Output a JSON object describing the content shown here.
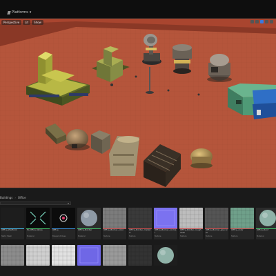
{
  "toolbar": {
    "platforms_label": "Platforms",
    "platforms_chevron": "▾"
  },
  "viewport": {
    "buttons": [
      {
        "label": "Perspective",
        "icon": "perspective-icon"
      },
      {
        "label": "Lit",
        "icon": "lit-icon"
      },
      {
        "label": "Show",
        "icon": "show-icon"
      }
    ],
    "right_icons": [
      "move-icon",
      "rotate-icon",
      "scale-icon",
      "grid-snap-icon",
      "camera-speed-icon"
    ],
    "ground_color": "#b5553b"
  },
  "content_browser": {
    "breadcrumb": [
      "Buildings",
      "Office"
    ],
    "breadcrumb_sep": "›",
    "filter_chevron": "▾",
    "assets": [
      {
        "name": "Office_Platform",
        "type": "Static Mesh",
        "thumb": "dark-platform",
        "color": "#1d1d1d",
        "bar": "#46b6e8"
      },
      {
        "name": "M_Office_Wires",
        "type": "Material",
        "thumb": "wire-pattern",
        "color": "#0a0a0a",
        "bar": "#43c06a"
      },
      {
        "name": "Office",
        "type": "Blueprint Class",
        "thumb": "office-blueprint",
        "color": "#0c0c0c",
        "bar": "#3b8fd9"
      },
      {
        "name": "Office_Border",
        "type": "Material",
        "thumb": "sphere-grey",
        "color": "#2b2b2b",
        "bar": "#43c06a"
      },
      {
        "name": "Office_Border_color",
        "type": "Texture",
        "thumb": "grey-panel",
        "color": "#7c7c7c",
        "bar": "#c94b4b"
      },
      {
        "name": "Office_Border_metallic",
        "type": "Texture",
        "thumb": "dark-panel",
        "color": "#3a3a3a",
        "bar": "#c94b4b"
      },
      {
        "name": "Office_Border_normal",
        "type": "Texture",
        "thumb": "normal-map",
        "color": "#7b72f0",
        "bar": "#c94b4b"
      },
      {
        "name": "Office_Border_roughness",
        "type": "Texture",
        "thumb": "light-panel",
        "color": "#bdbdbd",
        "bar": "#c94b4b"
      },
      {
        "name": "Office_Border_specular",
        "type": "Texture",
        "thumb": "spec-panel",
        "color": "#555555",
        "bar": "#c94b4b"
      },
      {
        "name": "Office_color",
        "type": "Texture",
        "thumb": "green-panel",
        "color": "#6fa08a",
        "bar": "#c94b4b"
      },
      {
        "name": "Office_Roof",
        "type": "Material",
        "thumb": "sphere-teal",
        "color": "#2b2b2b",
        "bar": "#43c06a"
      }
    ],
    "row2_assets": [
      {
        "thumb": "grey-tiles",
        "color": "#8c8c8c"
      },
      {
        "thumb": "light-tiles",
        "color": "#cfcfcf"
      },
      {
        "thumb": "white-tiles",
        "color": "#e1e1e1"
      },
      {
        "thumb": "normal-map",
        "color": "#6f67e6"
      },
      {
        "thumb": "grey-tiles",
        "color": "#9a9a9a"
      },
      {
        "thumb": "dark-tiles",
        "color": "#333333"
      },
      {
        "thumb": "sphere-teal",
        "color": "#1d1d1d"
      }
    ]
  }
}
